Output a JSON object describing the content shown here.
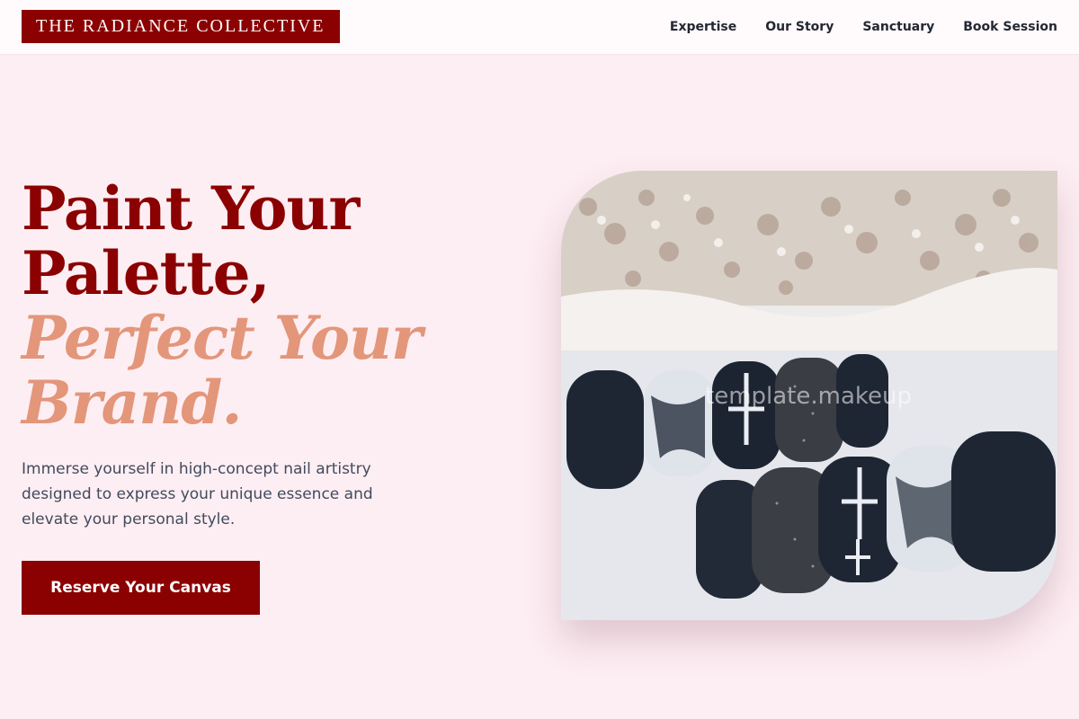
{
  "brand": {
    "name": "THE RADIANCE COLLECTIVE",
    "color": "#8b0000"
  },
  "nav": {
    "items": [
      {
        "label": "Expertise"
      },
      {
        "label": "Our Story"
      },
      {
        "label": "Sanctuary"
      },
      {
        "label": "Book Session"
      }
    ]
  },
  "hero": {
    "headline_line1": "Paint Your",
    "headline_line2": "Palette,",
    "headline_line3": "Perfect Your",
    "headline_line4": "Brand.",
    "description": "Immerse yourself in high-concept nail artistry designed to express your unique essence and elevate your personal style.",
    "cta_label": "Reserve Your Canvas",
    "image_watermark": "template.makeup"
  },
  "colors": {
    "background": "#fdeef3",
    "accent_dark": "#8b0000",
    "accent_light": "#e3967a",
    "text": "#424a5c"
  }
}
